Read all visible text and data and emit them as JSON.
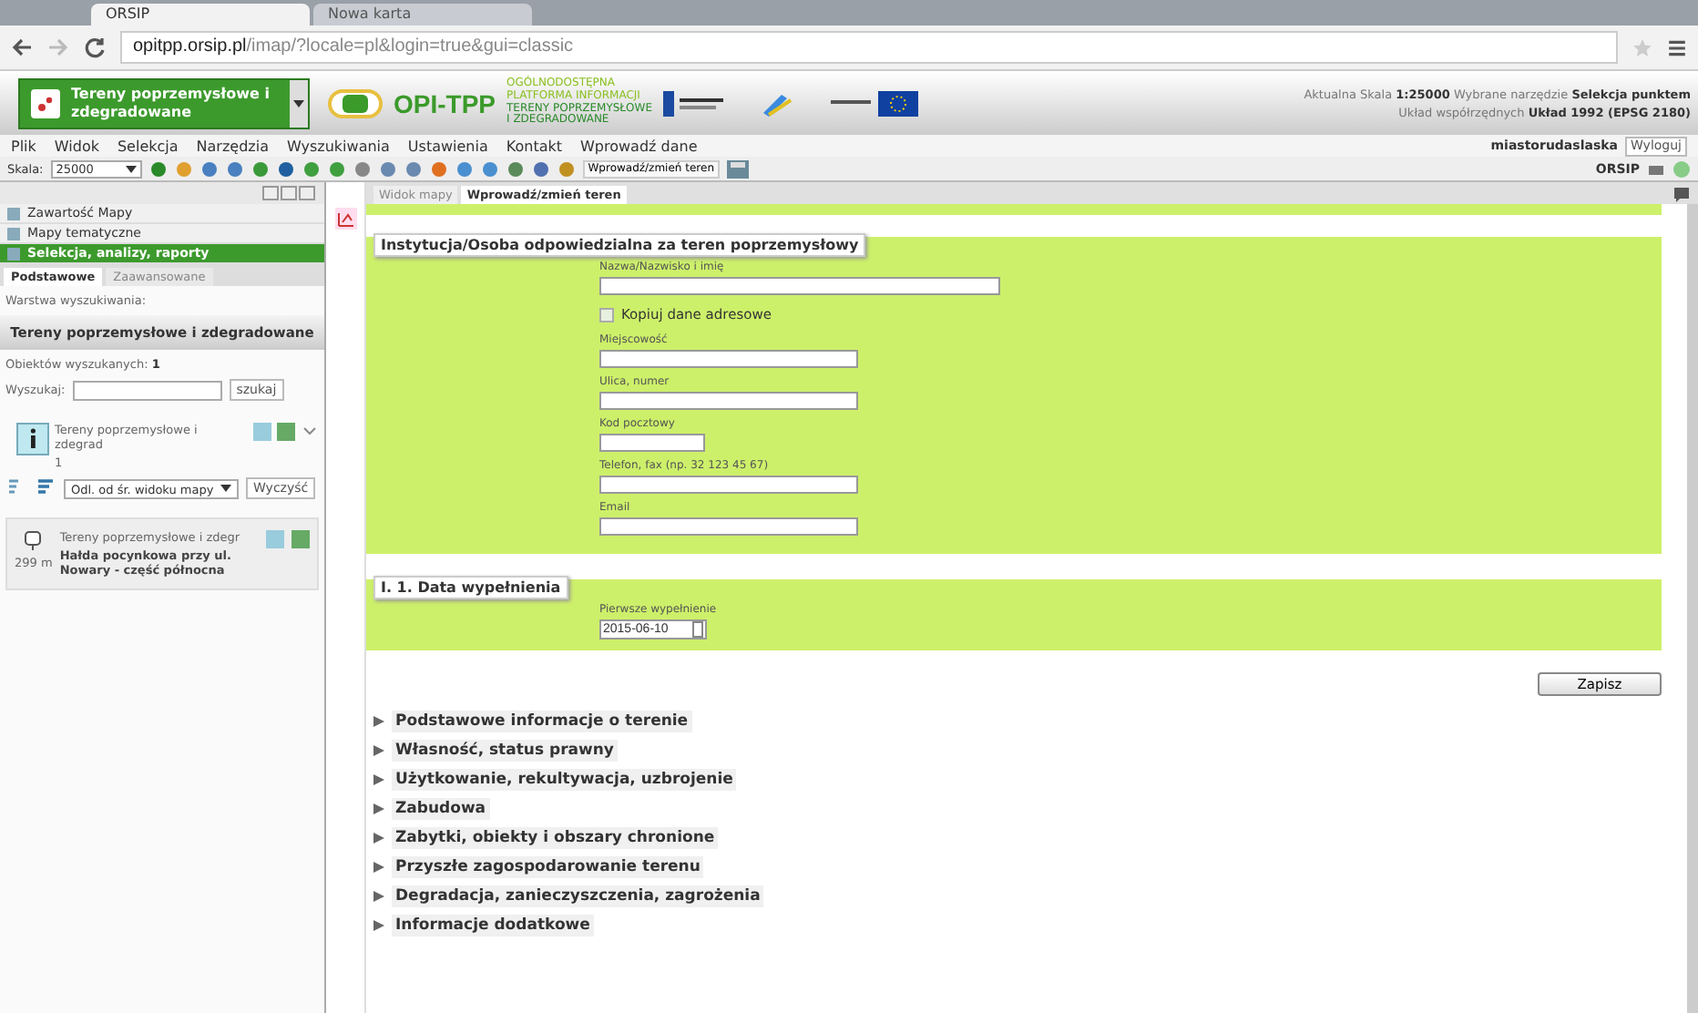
{
  "browser": {
    "tabs": [
      {
        "label": "ORSIP",
        "selected": true
      },
      {
        "label": "Nowa karta",
        "selected": false
      }
    ],
    "url_host": "opitpp.orsip.pl",
    "url_path": "/imap/?locale=pl&login=true&gui=classic"
  },
  "header": {
    "layer_title": "Tereny poprzemysłowe i zdegradowane",
    "brand": "OPI-TPP",
    "brand_lines": [
      "OGÓLNODOSTĘPNA",
      "PLATFORMA INFORMACJI",
      "TERENY POPRZEMYSŁOWE",
      "I ZDEGRADOWANE"
    ],
    "scale_label": "Aktualna Skala",
    "scale_value": "1:25000",
    "tool_label": "Wybrane narzędzie",
    "tool_value": "Selekcja punktem",
    "crs_label": "Układ współrzędnych",
    "crs_value": "Układ 1992 (EPSG 2180)",
    "user": "miastorudaslaska",
    "logout": "Wyloguj"
  },
  "menu": [
    "Plik",
    "Widok",
    "Selekcja",
    "Narzędzia",
    "Wyszukiwania",
    "Ustawienia",
    "Kontakt",
    "Wprowadź dane"
  ],
  "toolbar": {
    "scale_label": "Skala:",
    "scale_value": "25000",
    "enter_button": "Wprowadź/zmień teren",
    "orsip": "ORSIP"
  },
  "sidebar": {
    "panels": [
      {
        "title": "Zawartość Mapy",
        "selected": false
      },
      {
        "title": "Mapy tematyczne",
        "selected": false
      },
      {
        "title": "Selekcja, analizy, raporty",
        "selected": true
      }
    ],
    "subtabs": [
      {
        "label": "Podstawowe",
        "selected": true
      },
      {
        "label": "Zaawansowane",
        "selected": false
      }
    ],
    "layer_label": "Warstwa wyszukiwania:",
    "layer_name": "Tereny poprzemysłowe i zdegradowane",
    "found_label": "Obiektów wyszukanych:",
    "found_count": "1",
    "search_label": "Wyszukaj:",
    "search_button": "szukaj",
    "group_title": "Tereny poprzemysłowe i zdegrad",
    "group_count": "1",
    "sort": "Odl. od śr. widoku mapy",
    "clear": "Wyczyść",
    "result": {
      "distance": "299 m",
      "layer": "Tereny poprzemysłowe i zdegr",
      "name": "Hałda pocynkowa przy ul. Nowary - część północna"
    }
  },
  "content_tabs": [
    {
      "label": "Widok mapy",
      "selected": false
    },
    {
      "label": "Wprowadź/zmień teren",
      "selected": true
    }
  ],
  "section1": {
    "title": "Instytucja/Osoba odpowiedzialna za teren poprzemysłowy",
    "fields": [
      {
        "kind": "wide_text",
        "label": "Nazwa/Nazwisko i imię"
      },
      {
        "kind": "checkbox",
        "label": "Kopiuj dane adresowe",
        "checked": false
      },
      {
        "kind": "text",
        "label": "Miejscowość"
      },
      {
        "kind": "text",
        "label": "Ulica, numer"
      },
      {
        "kind": "short_text",
        "label": "Kod pocztowy"
      },
      {
        "kind": "text",
        "label": "Telefon, fax (np. 32 123 45 67)"
      },
      {
        "kind": "text",
        "label": "Email"
      }
    ]
  },
  "section2": {
    "title": "I. 1. Data wypełnienia",
    "field_label": "Pierwsze wypełnienie",
    "value": "2015-06-10"
  },
  "save": "Zapisz",
  "accordion": [
    "Podstawowe informacje o terenie",
    "Własność, status prawny",
    "Użytkowanie, rekultywacja, uzbrojenie",
    "Zabudowa",
    "Zabytki, obiekty i obszary chronione",
    "Przyszłe zagospodarowanie terenu",
    "Degradacja, zanieczyszczenia, zagrożenia",
    "Informacje dodatkowe"
  ]
}
